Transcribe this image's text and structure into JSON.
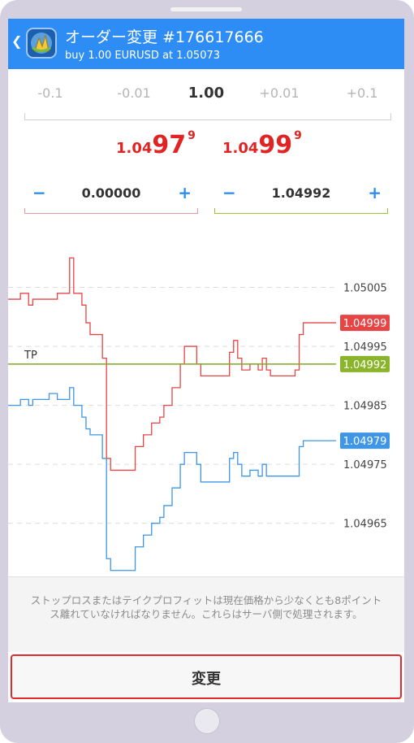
{
  "header": {
    "title": "オーダー変更 #176617666",
    "subtitle": "buy 1.00 EURUSD at 1.05073",
    "back_icon": "chevron-left-icon",
    "logo_icon": "metatrader-logo-icon",
    "color": "#2e8df5"
  },
  "volume": {
    "steps": [
      "-0.1",
      "-0.01",
      "1.00",
      "+0.01",
      "+0.1"
    ],
    "selected_index": 2
  },
  "quotes": {
    "bid": {
      "prefix": "1.04",
      "big": "97",
      "sup": "9"
    },
    "ask": {
      "prefix": "1.04",
      "big": "99",
      "sup": "9"
    },
    "color": "#e02424"
  },
  "stop_loss": {
    "minus": "−",
    "value": "0.00000",
    "plus": "+"
  },
  "take_profit": {
    "minus": "−",
    "value": "1.04992",
    "plus": "+"
  },
  "chart_data": {
    "type": "line",
    "y_ticks": [
      "1.05005",
      "1.04995",
      "1.04985",
      "1.04975",
      "1.04965"
    ],
    "tick_values": [
      1.05005,
      1.04995,
      1.04985,
      1.04975,
      1.04965
    ],
    "ylim": [
      1.04956,
      1.05015
    ],
    "grid": true,
    "series": [
      {
        "color": "#e64545",
        "points": [
          [
            0,
            1.05003
          ],
          [
            2,
            1.05003
          ],
          [
            3,
            1.05004
          ],
          [
            5,
            1.05002
          ],
          [
            6,
            1.05003
          ],
          [
            8,
            1.05003
          ],
          [
            10,
            1.05003
          ],
          [
            12,
            1.05004
          ],
          [
            14,
            1.05004
          ],
          [
            15,
            1.0501
          ],
          [
            16,
            1.05004
          ],
          [
            18,
            1.05002
          ],
          [
            19,
            1.04999
          ],
          [
            20,
            1.04997
          ],
          [
            22,
            1.04997
          ],
          [
            23,
            1.04993
          ],
          [
            24,
            1.04976
          ],
          [
            25,
            1.04974
          ],
          [
            27,
            1.04974
          ],
          [
            29,
            1.04974
          ],
          [
            30,
            1.04974
          ],
          [
            31,
            1.04978
          ],
          [
            33,
            1.0498
          ],
          [
            35,
            1.04982
          ],
          [
            37,
            1.04983
          ],
          [
            38,
            1.04985
          ],
          [
            40,
            1.04988
          ],
          [
            42,
            1.04992
          ],
          [
            43,
            1.04995
          ],
          [
            45,
            1.04995
          ],
          [
            46,
            1.04992
          ],
          [
            47,
            1.0499
          ],
          [
            48,
            1.0499
          ],
          [
            50,
            1.0499
          ],
          [
            52,
            1.0499
          ],
          [
            54,
            1.04994
          ],
          [
            55,
            1.04996
          ],
          [
            56,
            1.04993
          ],
          [
            57,
            1.04991
          ],
          [
            59,
            1.04992
          ],
          [
            61,
            1.04991
          ],
          [
            62,
            1.04993
          ],
          [
            63,
            1.04991
          ],
          [
            64,
            1.0499
          ],
          [
            66,
            1.0499
          ],
          [
            68,
            1.0499
          ],
          [
            70,
            1.04991
          ],
          [
            71,
            1.04997
          ],
          [
            72,
            1.04999
          ],
          [
            73,
            1.04999
          ],
          [
            75,
            1.04999
          ],
          [
            77,
            1.04999
          ],
          [
            80,
            1.04999
          ]
        ]
      },
      {
        "color": "#3f95e6",
        "points": [
          [
            0,
            1.04985
          ],
          [
            2,
            1.04985
          ],
          [
            3,
            1.04986
          ],
          [
            5,
            1.04985
          ],
          [
            6,
            1.04986
          ],
          [
            8,
            1.04986
          ],
          [
            10,
            1.04987
          ],
          [
            12,
            1.04986
          ],
          [
            14,
            1.04986
          ],
          [
            15,
            1.04988
          ],
          [
            16,
            1.04985
          ],
          [
            18,
            1.04983
          ],
          [
            19,
            1.04981
          ],
          [
            20,
            1.0498
          ],
          [
            22,
            1.0498
          ],
          [
            23,
            1.04976
          ],
          [
            24,
            1.04959
          ],
          [
            25,
            1.04957
          ],
          [
            27,
            1.04957
          ],
          [
            29,
            1.04957
          ],
          [
            30,
            1.04957
          ],
          [
            31,
            1.04961
          ],
          [
            33,
            1.04963
          ],
          [
            35,
            1.04965
          ],
          [
            37,
            1.04966
          ],
          [
            38,
            1.04968
          ],
          [
            40,
            1.04971
          ],
          [
            42,
            1.04975
          ],
          [
            43,
            1.04977
          ],
          [
            45,
            1.04977
          ],
          [
            46,
            1.04975
          ],
          [
            47,
            1.04972
          ],
          [
            48,
            1.04972
          ],
          [
            50,
            1.04972
          ],
          [
            52,
            1.04972
          ],
          [
            54,
            1.04976
          ],
          [
            55,
            1.04977
          ],
          [
            56,
            1.04975
          ],
          [
            57,
            1.04973
          ],
          [
            59,
            1.04974
          ],
          [
            61,
            1.04973
          ],
          [
            62,
            1.04975
          ],
          [
            63,
            1.04973
          ],
          [
            64,
            1.04973
          ],
          [
            66,
            1.04973
          ],
          [
            68,
            1.04973
          ],
          [
            70,
            1.04973
          ],
          [
            71,
            1.04978
          ],
          [
            72,
            1.04979
          ],
          [
            73,
            1.04979
          ],
          [
            75,
            1.04979
          ],
          [
            77,
            1.04979
          ],
          [
            80,
            1.04979
          ]
        ]
      }
    ],
    "tp_line": {
      "label": "TP",
      "value": 1.04992,
      "color": "#7fa823"
    },
    "price_tags": [
      {
        "text": "1.04999",
        "value": 1.04999,
        "color": "#e64545"
      },
      {
        "text": "1.04992",
        "value": 1.04992,
        "color": "#8ab42a"
      },
      {
        "text": "1.04979",
        "value": 1.04979,
        "color": "#3f95e6"
      }
    ]
  },
  "notice": "ストップロスまたはテイクプロフィットは現在価格から少なくとも8ポイントス離れていなければなりません。これらはサーバ側で処理されます。",
  "submit_label": "変更"
}
